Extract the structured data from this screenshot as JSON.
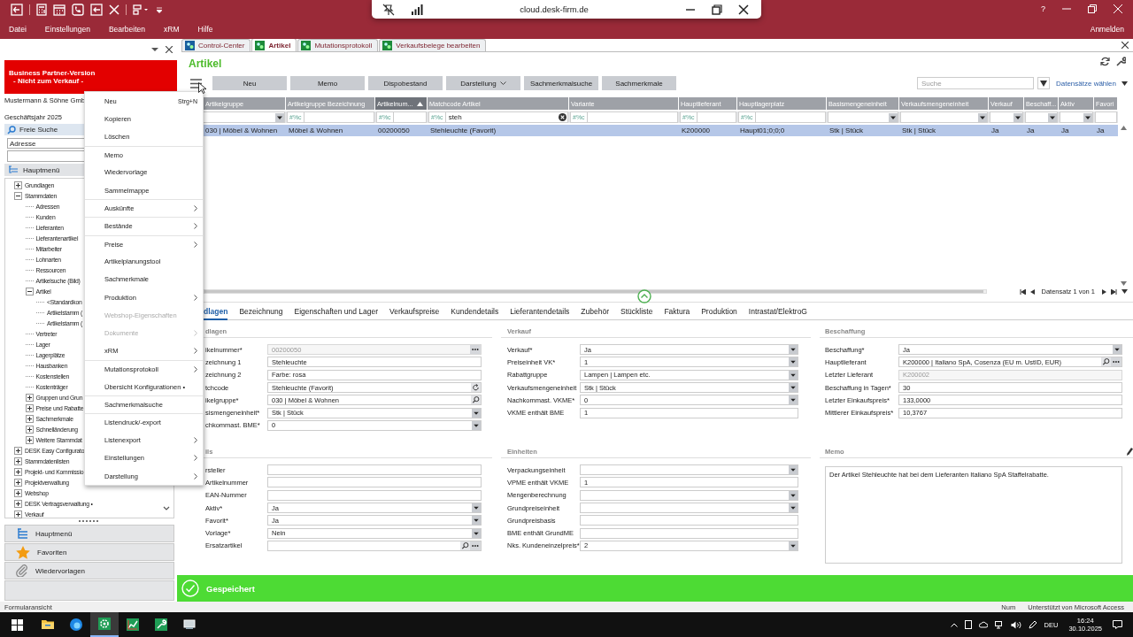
{
  "remote_bar": {
    "host": "cloud.desk-firm.de"
  },
  "window_controls": {
    "help": "?"
  },
  "menu_bar": {
    "items": [
      "Datei",
      "Einstellungen",
      "Bearbeiten",
      "xRM",
      "Hilfe"
    ],
    "account": "Anmelden"
  },
  "sidebar": {
    "banner": [
      "Business Partner-Version",
      "- Nicht zum Verkauf -"
    ],
    "company": "Mustermann & Söhne Gmb",
    "fiscal_year": "Geschäftsjahr 2025",
    "search_label": "Freie Suche",
    "search_scope": "Adresse",
    "tree_title": "Hauptmenü",
    "tree": [
      {
        "label": "Grundlagen",
        "kind": "folder",
        "expanded": false
      },
      {
        "label": "Stammdaten",
        "kind": "folder",
        "expanded": true,
        "children": [
          {
            "label": "Adressen",
            "kind": "leaf"
          },
          {
            "label": "Kunden",
            "kind": "leaf"
          },
          {
            "label": "Lieferanten",
            "kind": "leaf"
          },
          {
            "label": "Lieferantenartikel",
            "kind": "leaf"
          },
          {
            "label": "Mitarbeiter",
            "kind": "leaf"
          },
          {
            "label": "Lohnarten",
            "kind": "leaf"
          },
          {
            "label": "Ressourcen",
            "kind": "leaf"
          },
          {
            "label": "Artikelsuche (Bild)",
            "kind": "leaf"
          },
          {
            "label": "Artikel",
            "kind": "folder",
            "expanded": true,
            "children": [
              {
                "label": "<Standardkon",
                "kind": "leaf"
              },
              {
                "label": "Artikelstamm (",
                "kind": "leaf"
              },
              {
                "label": "Artikelstamm (",
                "kind": "leaf"
              }
            ]
          },
          {
            "label": "Vertreter",
            "kind": "leaf"
          },
          {
            "label": "Lager",
            "kind": "leaf"
          },
          {
            "label": "Lagerplätze",
            "kind": "leaf"
          },
          {
            "label": "Hausbanken",
            "kind": "leaf"
          },
          {
            "label": "Kostenstellen",
            "kind": "leaf"
          },
          {
            "label": "Kostenträger",
            "kind": "leaf"
          },
          {
            "label": "Gruppen und Grun",
            "kind": "folder",
            "expanded": false
          },
          {
            "label": "Preise und Rabatte",
            "kind": "folder",
            "expanded": false
          },
          {
            "label": "Sachmerkmale",
            "kind": "folder",
            "expanded": false
          },
          {
            "label": "Schnelländerung",
            "kind": "folder",
            "expanded": false
          },
          {
            "label": "Weitere Stammdat",
            "kind": "folder",
            "expanded": false
          }
        ]
      },
      {
        "label": "DESK Easy Configurato",
        "kind": "folder",
        "expanded": false
      },
      {
        "label": "Stammdatenlisten",
        "kind": "folder",
        "expanded": false
      },
      {
        "label": "Projekt- und Kommissio",
        "kind": "folder",
        "expanded": false
      },
      {
        "label": "Projektverwaltung",
        "kind": "folder",
        "expanded": false
      },
      {
        "label": "Webshop",
        "kind": "folder",
        "expanded": false
      },
      {
        "label": "DESK Vertragsverwaltung •",
        "kind": "folder",
        "expanded": false
      },
      {
        "label": "Verkauf",
        "kind": "folder",
        "expanded": false
      }
    ],
    "nav": [
      {
        "label": "Hauptmenü",
        "kind": "menu"
      },
      {
        "label": "Favoriten",
        "kind": "star"
      },
      {
        "label": "Wiedervorlagen",
        "kind": "clip"
      }
    ]
  },
  "doc_tabs": [
    {
      "label": "Control-Center",
      "selected": false
    },
    {
      "label": "Artikel",
      "selected": true
    },
    {
      "label": "Mutationsprotokoll",
      "selected": false
    },
    {
      "label": "Verkaufsbelege bearbeiten",
      "selected": false
    }
  ],
  "page_title": "Artikel",
  "toolbar": {
    "buttons": [
      {
        "label": "Neu",
        "kind": "plain"
      },
      {
        "label": "Memo",
        "kind": "plain"
      },
      {
        "label": "Dispobestand",
        "kind": "plain"
      },
      {
        "label": "Darstellung",
        "kind": "dropdown"
      },
      {
        "label": "Sachmerkmalsuche",
        "kind": "plain"
      },
      {
        "label": "Sachmerkmale",
        "kind": "plain"
      }
    ],
    "search": {
      "placeholder": "Suche"
    },
    "record_picker": "Datensätze wählen"
  },
  "context_menu": [
    {
      "label": "Neu",
      "shortcut": "Strg+N",
      "submenu": false,
      "disabled": false,
      "group_start": false
    },
    {
      "label": "Kopieren",
      "submenu": false,
      "disabled": false,
      "group_start": false
    },
    {
      "label": "Löschen",
      "submenu": false,
      "disabled": false,
      "group_start": false
    },
    {
      "label": "Memo",
      "submenu": false,
      "disabled": false,
      "group_start": true
    },
    {
      "label": "Wiedervorlage",
      "submenu": false,
      "disabled": false,
      "group_start": false
    },
    {
      "label": "Sammelmappe",
      "submenu": false,
      "disabled": false,
      "group_start": false
    },
    {
      "label": "Auskünfte",
      "submenu": true,
      "disabled": false,
      "group_start": true
    },
    {
      "label": "Bestände",
      "submenu": true,
      "disabled": false,
      "group_start": true
    },
    {
      "label": "Preise",
      "submenu": true,
      "disabled": false,
      "group_start": true
    },
    {
      "label": "Artikelplanungstool",
      "submenu": false,
      "disabled": false,
      "group_start": false
    },
    {
      "label": "Sachmerkmale",
      "submenu": false,
      "disabled": false,
      "group_start": false
    },
    {
      "label": "Produktion",
      "submenu": true,
      "disabled": false,
      "group_start": false
    },
    {
      "label": "Webshop-Eigenschaften",
      "submenu": false,
      "disabled": true,
      "group_start": false
    },
    {
      "label": "Dokumente",
      "submenu": true,
      "disabled": true,
      "group_start": false
    },
    {
      "label": "xRM",
      "submenu": true,
      "disabled": false,
      "group_start": false
    },
    {
      "label": "Mutationsprotokoll",
      "submenu": true,
      "disabled": false,
      "group_start": true
    },
    {
      "label": "Übersicht Konfigurationen •",
      "submenu": false,
      "disabled": false,
      "group_start": false
    },
    {
      "label": "Sachmerkmalsuche",
      "submenu": false,
      "disabled": false,
      "group_start": true
    },
    {
      "label": "Listendruck/-export",
      "submenu": false,
      "disabled": false,
      "group_start": true
    },
    {
      "label": "Listenexport",
      "submenu": true,
      "disabled": false,
      "group_start": false
    },
    {
      "label": "Einstellungen",
      "submenu": true,
      "disabled": false,
      "group_start": false
    },
    {
      "label": "Darstellung",
      "submenu": true,
      "disabled": false,
      "group_start": false
    }
  ],
  "grid": {
    "columns": [
      {
        "label": "Artikelgruppe",
        "sorted": false
      },
      {
        "label": "Artikelgruppe Bezeichnung",
        "sorted": false
      },
      {
        "label": "Artikelnum...",
        "sorted": true
      },
      {
        "label": "Matchcode Artikel",
        "sorted": false
      },
      {
        "label": "Variante",
        "sorted": false
      },
      {
        "label": "Hauptlieferant",
        "sorted": false
      },
      {
        "label": "Hauptlagerplatz",
        "sorted": false
      },
      {
        "label": "Basismengeneinheit",
        "sorted": false
      },
      {
        "label": "Verkaufsmengeneinheit",
        "sorted": false
      },
      {
        "label": "Verkauf",
        "sorted": false
      },
      {
        "label": "Beschaff...",
        "sorted": false
      },
      {
        "label": "Aktiv",
        "sorted": false
      },
      {
        "label": "Favori",
        "sorted": false
      }
    ],
    "filters": [
      {
        "kind": "dropdown"
      },
      {
        "kind": "text",
        "mode": "#%c"
      },
      {
        "kind": "text",
        "mode": "#%c"
      },
      {
        "kind": "text_clear",
        "mode": "#%c",
        "value": "steh"
      },
      {
        "kind": "text",
        "mode": "#%c"
      },
      {
        "kind": "text",
        "mode": "#%c"
      },
      {
        "kind": "text",
        "mode": "#%c"
      },
      {
        "kind": "dropdown"
      },
      {
        "kind": "dropdown"
      },
      {
        "kind": "dropdown"
      },
      {
        "kind": "dropdown"
      },
      {
        "kind": "dropdown"
      },
      {
        "kind": "blank"
      }
    ],
    "rows": [
      {
        "selected": true,
        "cells": [
          "030  |  Möbel & Wohnen",
          "Möbel & Wohnen",
          "00200050",
          "Stehleuchte  (Favorit)",
          "",
          "K200000",
          "Haupt01;0;0;0",
          "Stk  |  Stück",
          "Stk  |  Stück",
          "Ja",
          "Ja",
          "Ja",
          "Ja"
        ]
      }
    ],
    "record_info": "Datensatz 1 von 1"
  },
  "detail_tabs": [
    {
      "label": "dlagen",
      "selected": true
    },
    {
      "label": "Bezeichnung",
      "selected": false
    },
    {
      "label": "Eigenschaften und Lager",
      "selected": false
    },
    {
      "label": "Verkaufspreise",
      "selected": false
    },
    {
      "label": "Kundendetails",
      "selected": false
    },
    {
      "label": "Lieferantendetails",
      "selected": false
    },
    {
      "label": "Zubehör",
      "selected": false
    },
    {
      "label": "Stückliste",
      "selected": false
    },
    {
      "label": "Faktura",
      "selected": false
    },
    {
      "label": "Produktion",
      "selected": false
    },
    {
      "label": "Intrastat/ElektroG",
      "selected": false
    }
  ],
  "sections": [
    {
      "title": "dlagen",
      "kind": "fields",
      "fields": [
        {
          "label": "ikelnummer*",
          "kind": "dots",
          "readonly": true,
          "value": "00200050"
        },
        {
          "label": "zeichnung 1",
          "kind": "text",
          "readonly": false,
          "value": "Stehleuchte"
        },
        {
          "label": "zeichnung 2",
          "kind": "text",
          "readonly": false,
          "value": "Farbe: rosa"
        },
        {
          "label": "tchcode",
          "kind": "refresh",
          "readonly": false,
          "value": "Stehleuchte  (Favorit)"
        },
        {
          "label": "ikelgruppe*",
          "kind": "search",
          "readonly": false,
          "value": "030 | Möbel & Wohnen"
        },
        {
          "label": "sismengeneinheit*",
          "kind": "dropdown",
          "readonly": false,
          "value": "Stk  |  Stück"
        },
        {
          "label": "chkommast. BME*",
          "kind": "dropdown",
          "readonly": false,
          "value": "0"
        }
      ]
    },
    {
      "title": "Verkauf",
      "kind": "fields",
      "fields": [
        {
          "label": "Verkauf*",
          "kind": "dropdown",
          "readonly": false,
          "value": "Ja"
        },
        {
          "label": "Preiseinheit VK*",
          "kind": "dropdown",
          "readonly": false,
          "value": "1"
        },
        {
          "label": "Rabattgruppe",
          "kind": "dropdown",
          "readonly": false,
          "value": "Lampen  |  Lampen etc."
        },
        {
          "label": "Verkaufsmengeneinheit",
          "kind": "dropdown",
          "readonly": false,
          "value": "Stk  |  Stück"
        },
        {
          "label": "Nachkommast. VKME*",
          "kind": "dropdown",
          "readonly": false,
          "value": "0"
        },
        {
          "label": "VKME enthält BME",
          "kind": "text",
          "readonly": false,
          "value": "1"
        }
      ]
    },
    {
      "title": "Beschaffung",
      "kind": "fields",
      "fields": [
        {
          "label": "Beschaffung*",
          "kind": "dropdown",
          "readonly": false,
          "value": "Ja"
        },
        {
          "label": "Hauptlieferant",
          "kind": "search_dots",
          "readonly": false,
          "value": "K200000  |  Italiano SpA, Cosenza (EU m. UstID, EUR)"
        },
        {
          "label": "Letzter Lieferant",
          "kind": "text",
          "readonly": true,
          "value": "K200002"
        },
        {
          "label": "Beschaffung in Tagen*",
          "kind": "text",
          "readonly": false,
          "value": "30"
        },
        {
          "label": "Letzter Einkaufspreis*",
          "kind": "text",
          "readonly": false,
          "value": "133,0000"
        },
        {
          "label": "Mittlerer Einkaufspreis*",
          "kind": "text",
          "readonly": false,
          "value": "10,3767"
        }
      ]
    },
    {
      "title": "ils",
      "kind": "fields",
      "fields": [
        {
          "label": "rsteller",
          "kind": "text",
          "readonly": false
        },
        {
          "label": "Artikelnummer",
          "kind": "text",
          "readonly": false
        },
        {
          "label": "EAN-Nummer",
          "kind": "text",
          "readonly": false
        },
        {
          "label": "Aktiv*",
          "kind": "dropdown",
          "readonly": false,
          "value": "Ja"
        },
        {
          "label": "Favorit*",
          "kind": "dropdown",
          "readonly": false,
          "value": "Ja"
        },
        {
          "label": "Vorlage*",
          "kind": "dropdown",
          "readonly": false,
          "value": "Nein"
        },
        {
          "label": "Ersatzartikel",
          "kind": "search_dots",
          "readonly": false
        }
      ]
    },
    {
      "title": "Einheiten",
      "kind": "fields",
      "fields": [
        {
          "label": "Verpackungseinheit",
          "kind": "dropdown",
          "readonly": false
        },
        {
          "label": "VPME enthält VKME",
          "kind": "text",
          "readonly": false,
          "value": "1"
        },
        {
          "label": "Mengenberechnung",
          "kind": "dropdown",
          "readonly": false
        },
        {
          "label": "Grundpreiseinheit",
          "kind": "dropdown",
          "readonly": false
        },
        {
          "label": "Grundpreisbasis",
          "kind": "text",
          "readonly": false
        },
        {
          "label": "BME enthält GrundME",
          "kind": "text",
          "readonly": false
        },
        {
          "label": "Nks. Kundeneinzelpreis*",
          "kind": "dropdown",
          "readonly": false,
          "value": "2"
        }
      ]
    },
    {
      "title": "Memo",
      "kind": "memo",
      "text": "Der Artikel Stehleuchte hat bei dem Lieferanten Italiano SpA Staffelrabatte."
    }
  ],
  "status_message": "Gespeichert",
  "status_bar": {
    "view": "Formularansicht",
    "items": [
      "Num",
      "Unterstützt von Microsoft Access"
    ]
  },
  "taskbar": {
    "apps": [
      {
        "kind": "folder",
        "selected": false
      },
      {
        "kind": "browser",
        "selected": false
      },
      {
        "kind": "gear",
        "selected": true
      },
      {
        "kind": "chart",
        "selected": false
      },
      {
        "kind": "wrench",
        "selected": false
      },
      {
        "kind": "remote",
        "selected": false
      }
    ],
    "language": "DEU",
    "time": "16:24",
    "date": "30.10.2025"
  }
}
